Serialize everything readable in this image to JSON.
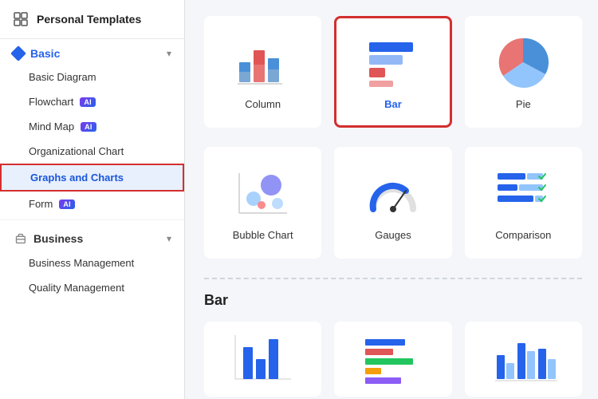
{
  "sidebar": {
    "header": {
      "title": "Personal Templates",
      "icon": "grid-icon"
    },
    "sections": [
      {
        "id": "basic",
        "label": "Basic",
        "expanded": true,
        "items": [
          {
            "id": "basic-diagram",
            "label": "Basic Diagram",
            "ai": false,
            "active": false
          },
          {
            "id": "flowchart",
            "label": "Flowchart",
            "ai": true,
            "active": false
          },
          {
            "id": "mind-map",
            "label": "Mind Map",
            "ai": true,
            "active": false
          },
          {
            "id": "org-chart",
            "label": "Organizational Chart",
            "ai": false,
            "active": false
          },
          {
            "id": "graphs-charts",
            "label": "Graphs and Charts",
            "ai": false,
            "active": true
          },
          {
            "id": "form",
            "label": "Form",
            "ai": true,
            "active": false
          }
        ]
      },
      {
        "id": "business",
        "label": "Business",
        "expanded": true,
        "items": [
          {
            "id": "business-management",
            "label": "Business Management",
            "ai": false,
            "active": false
          },
          {
            "id": "quality-management",
            "label": "Quality Management",
            "ai": false,
            "active": false
          }
        ]
      }
    ]
  },
  "main": {
    "selected_section": "Graphs and Charts",
    "top_row": [
      {
        "id": "column",
        "label": "Column",
        "selected": false
      },
      {
        "id": "bar",
        "label": "Bar",
        "selected": true
      },
      {
        "id": "pie",
        "label": "Pie",
        "selected": false
      }
    ],
    "bottom_row_top": [
      {
        "id": "bubble-chart",
        "label": "Bubble Chart",
        "selected": false
      },
      {
        "id": "gauges",
        "label": "Gauges",
        "selected": false
      },
      {
        "id": "comparison",
        "label": "Comparison",
        "selected": false
      }
    ],
    "section_label": "Bar",
    "bottom_cards": [
      {
        "id": "bar-1",
        "label": ""
      },
      {
        "id": "bar-2",
        "label": ""
      },
      {
        "id": "bar-3",
        "label": ""
      }
    ]
  }
}
